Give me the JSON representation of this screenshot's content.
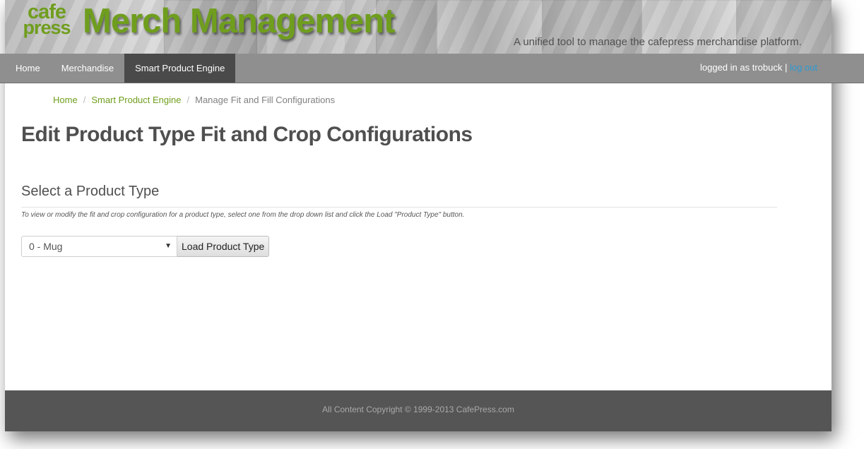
{
  "header": {
    "logo_line1": "cafe",
    "logo_line2": "press",
    "title": "Merch Management",
    "tagline": "A unified tool to manage the cafepress merchandise platform.",
    "brand_color": "#6f9e1e"
  },
  "nav": {
    "items": [
      {
        "label": "Home",
        "active": false
      },
      {
        "label": "Merchandise",
        "active": false
      },
      {
        "label": "Smart Product Engine",
        "active": true
      }
    ],
    "user_prefix": "logged in as trobuck |",
    "logout_label": "log out"
  },
  "breadcrumb": {
    "home": "Home",
    "section": "Smart Product Engine",
    "current": "Manage Fit and Fill Configurations",
    "separator": "/"
  },
  "main": {
    "page_title": "Edit Product Type Fit and Crop Configurations",
    "section_title": "Select a Product Type",
    "instructions": "To view or modify the fit and crop configuration for a product type, select one from the drop down list and click the Load \"Product Type\" button.",
    "product_type_select": {
      "selected": "0 - Mug",
      "arrow_icon": "caret-down-icon"
    },
    "load_button_label": "Load Product Type"
  },
  "footer": {
    "copyright": "All Content Copyright © 1999-2013 CafePress.com"
  }
}
